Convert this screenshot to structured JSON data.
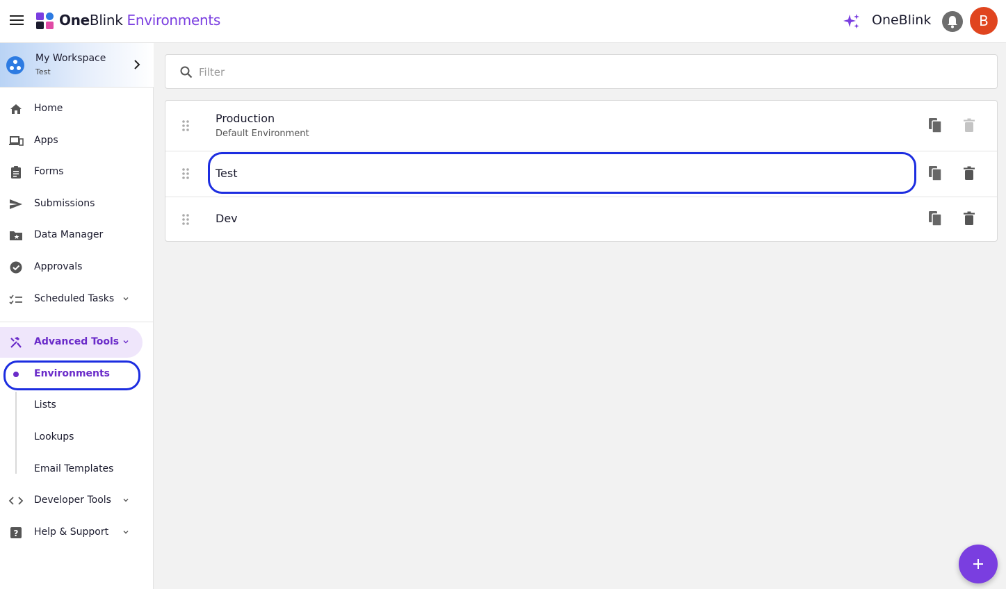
{
  "app": {
    "brand_bold": "One",
    "brand_rest": "Blink",
    "section": "Environments",
    "org_name": "OneBlink",
    "avatar_initial": "B",
    "accent": "#7a3ee0",
    "avatar_color": "#e0451f"
  },
  "workspace": {
    "title": "My Workspace",
    "subtitle": "Test"
  },
  "nav": {
    "items": [
      {
        "label": "Home",
        "icon": "home-icon"
      },
      {
        "label": "Apps",
        "icon": "devices-icon"
      },
      {
        "label": "Forms",
        "icon": "clipboard-icon"
      },
      {
        "label": "Submissions",
        "icon": "send-icon"
      },
      {
        "label": "Data Manager",
        "icon": "folder-star-icon"
      },
      {
        "label": "Approvals",
        "icon": "check-circle-icon"
      },
      {
        "label": "Scheduled Tasks",
        "icon": "checklist-icon"
      }
    ],
    "advanced": {
      "label": "Advanced Tools",
      "icon": "tools-icon",
      "children": [
        "Environments",
        "Lists",
        "Lookups",
        "Email Templates"
      ],
      "active": "Environments"
    },
    "developer": {
      "label": "Developer Tools",
      "icon": "code-icon"
    },
    "help": {
      "label": "Help & Support",
      "icon": "help-icon"
    }
  },
  "filter": {
    "placeholder": "Filter",
    "value": ""
  },
  "environments": [
    {
      "name": "Production",
      "description": "Default Environment",
      "delete_enabled": false
    },
    {
      "name": "Test",
      "description": "",
      "delete_enabled": true
    },
    {
      "name": "Dev",
      "description": "",
      "delete_enabled": true
    }
  ]
}
